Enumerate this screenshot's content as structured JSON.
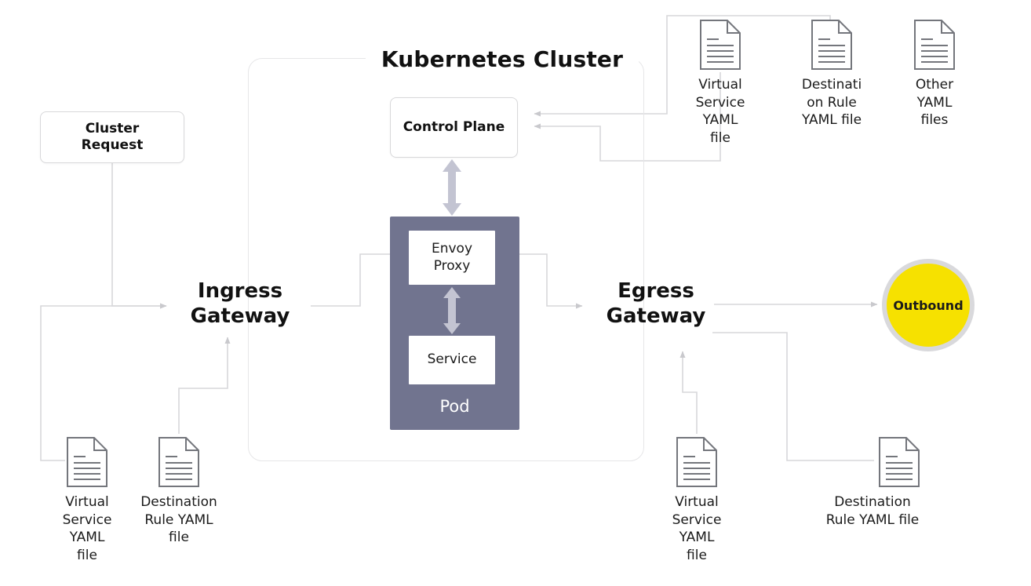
{
  "diagram": {
    "title": "Kubernetes Cluster",
    "colors": {
      "pod_fill": "#71748f",
      "outbound_fill": "#f6e100",
      "outbound_ring": "#d9d9dc",
      "wire": "#d5d5d8",
      "box_border": "#d8d8da",
      "cluster_border": "#e6e6e8",
      "text": "#1a1a1a"
    }
  },
  "nodes": {
    "cluster_request": "Cluster\nRequest",
    "control_plane": "Control Plane",
    "pod_label": "Pod",
    "envoy_proxy": "Envoy\nProxy",
    "service": "Service",
    "ingress_gateway": "Ingress\nGateway",
    "egress_gateway": "Egress\nGateway",
    "outbound": "Outbound"
  },
  "files": {
    "top": [
      {
        "id": "top-virtual-service",
        "caption": "Virtual\nService\nYAML file"
      },
      {
        "id": "top-destination-rule",
        "caption": "Destinati\non Rule\nYAML file"
      },
      {
        "id": "top-other-yaml",
        "caption": "Other\nYAML\nfiles"
      }
    ],
    "bottom_left": [
      {
        "id": "bl-virtual-service",
        "caption": "Virtual\nService\nYAML file"
      },
      {
        "id": "bl-destination-rule",
        "caption": "Destination\nRule YAML\nfile"
      }
    ],
    "bottom_right": [
      {
        "id": "br-virtual-service",
        "caption": "Virtual\nService\nYAML file"
      },
      {
        "id": "br-destination-rule",
        "caption": "Destination\nRule YAML file"
      }
    ]
  },
  "icons": {
    "document": "document-icon",
    "arrow_double_vertical": "double-headed-vertical-arrow-icon"
  }
}
